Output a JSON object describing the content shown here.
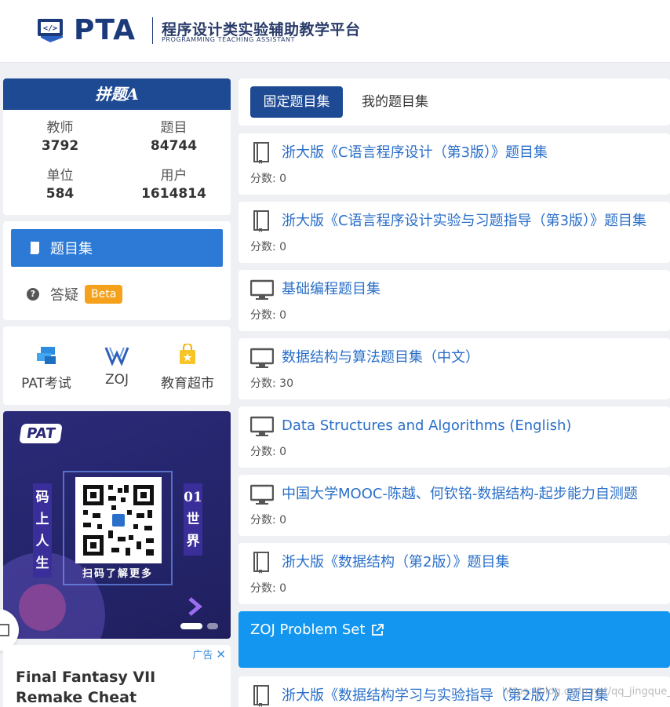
{
  "header": {
    "logo_text": "PTA",
    "subtitle_cn": "程序设计类实验辅助教学平台",
    "subtitle_en": "PROGRAMMING TEACHING ASSISTANT"
  },
  "stats": {
    "banner_text": "拼题A",
    "items": [
      {
        "label": "教师",
        "value": "3792"
      },
      {
        "label": "题目",
        "value": "84744"
      },
      {
        "label": "单位",
        "value": "584"
      },
      {
        "label": "用户",
        "value": "1614814"
      }
    ]
  },
  "nav": {
    "active_label": "题目集",
    "qa_label": "答疑",
    "beta_badge": "Beta"
  },
  "quick_links": [
    {
      "label": "PAT考试",
      "icon": "pat-icon"
    },
    {
      "label": "ZOJ",
      "icon": "zoj-icon"
    },
    {
      "label": "教育超市",
      "icon": "shopping-bag-icon"
    }
  ],
  "promo": {
    "badge": "PAT",
    "left_vertical": "码上人生",
    "right_vertical": "01世界",
    "caption": "扫码了解更多"
  },
  "ad": {
    "tag": "广告",
    "title": "Final Fantasy VII Remake Cheat"
  },
  "tabs": {
    "active": "固定题目集",
    "other": "我的题目集"
  },
  "problem_sets": [
    {
      "title": "浙大版《C语言程序设计（第3版）》题目集",
      "score": "分数: 0",
      "icon": "book-icon"
    },
    {
      "title": "浙大版《C语言程序设计实验与习题指导（第3版）》题目集",
      "score": "分数: 0",
      "icon": "book-icon"
    },
    {
      "title": "基础编程题目集",
      "score": "分数: 0",
      "icon": "monitor-icon"
    },
    {
      "title": "数据结构与算法题目集（中文）",
      "score": "分数: 30",
      "icon": "monitor-icon"
    },
    {
      "title": "Data Structures and Algorithms (English)",
      "score": "分数: 0",
      "icon": "monitor-icon"
    },
    {
      "title": "中国大学MOOC-陈越、何钦铭-数据结构-起步能力自测题",
      "score": "分数: 0",
      "icon": "monitor-icon"
    },
    {
      "title": "浙大版《数据结构（第2版）》题目集",
      "score": "分数: 0",
      "icon": "book-icon"
    }
  ],
  "zoj": {
    "title": "ZOJ Problem Set",
    "icon": "external-link-icon"
  },
  "last_set": {
    "title": "浙大版《数据结构学习与实验指导（第2版）》题目集",
    "icon": "book-icon"
  },
  "watermark": "https://blog.csdn.net/qq_jingque_helya",
  "colors": {
    "brand_dark": "#1e4a94",
    "nav_active": "#2d7ad6",
    "link": "#2a6fc9",
    "zoj_bg": "#1296ef",
    "beta": "#f5a11c"
  }
}
